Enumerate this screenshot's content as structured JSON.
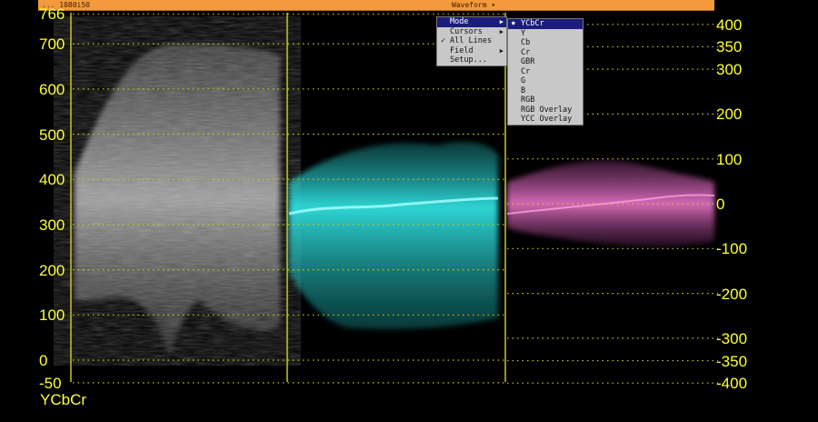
{
  "topbar": {
    "source": "... 1080i50",
    "title": "Waveform ▾"
  },
  "left_axis": {
    "labels": [
      "766",
      "700",
      "600",
      "500",
      "400",
      "300",
      "200",
      "100",
      "0",
      "-50"
    ]
  },
  "right_axis": {
    "labels": [
      "400",
      "350",
      "300",
      "200",
      "100",
      "0",
      "-100",
      "-200",
      "-300",
      "-350",
      "-400"
    ]
  },
  "mode_label": "YCbCr",
  "menu": {
    "items": [
      {
        "label": "Mode",
        "submenu": true,
        "selected": true
      },
      {
        "label": "Cursors",
        "submenu": true
      },
      {
        "label": "All Lines",
        "checked": true
      },
      {
        "label": "Field",
        "submenu": true
      },
      {
        "label": "Setup..."
      }
    ]
  },
  "mode_submenu": {
    "items": [
      "YCbCr",
      "Y",
      "Cb",
      "Cr",
      "GBR",
      "Cr",
      "G",
      "B",
      "RGB",
      "RGB Overlay",
      "YCC Overlay"
    ],
    "selected_index": 0
  },
  "colors": {
    "grid": "#ffff33",
    "bar": "#f39a3c",
    "y_trace": "#d0d0d0",
    "cb_trace": "#20c8c8",
    "cr_trace": "#d060b0"
  }
}
